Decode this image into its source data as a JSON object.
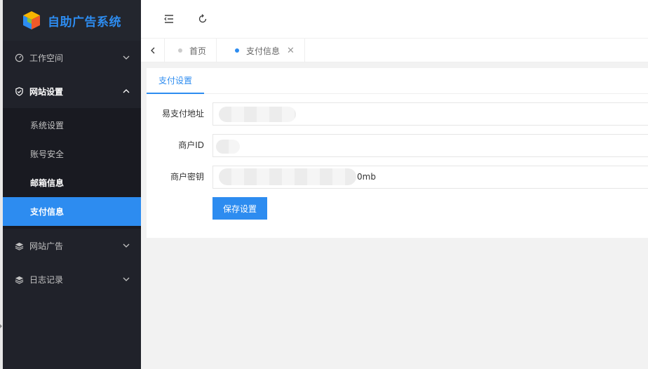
{
  "app": {
    "title": "自助广告系统"
  },
  "sidebar": {
    "groups": [
      {
        "label": "工作空间",
        "icon": "dashboard-icon",
        "open": false
      },
      {
        "label": "网站设置",
        "icon": "shield-icon",
        "open": true,
        "items": [
          {
            "label": "系统设置"
          },
          {
            "label": "账号安全"
          },
          {
            "label": "邮箱信息"
          },
          {
            "label": "支付信息",
            "active": true
          }
        ]
      },
      {
        "label": "网站广告",
        "icon": "layers-icon",
        "open": false
      },
      {
        "label": "日志记录",
        "icon": "layers-icon",
        "open": false
      }
    ]
  },
  "tabs": [
    {
      "label": "首页",
      "active": false
    },
    {
      "label": "支付信息",
      "active": true
    }
  ],
  "panel": {
    "tab_label": "支付设置",
    "fields": [
      {
        "label": "易支付地址",
        "value": ""
      },
      {
        "label": "商户ID",
        "value": ""
      },
      {
        "label": "商户密钥",
        "value": "0mb"
      }
    ],
    "save_label": "保存设置"
  },
  "colors": {
    "accent": "#2d8cf0",
    "sidebar_bg": "#20222a",
    "submenu_bg": "#191a21"
  }
}
